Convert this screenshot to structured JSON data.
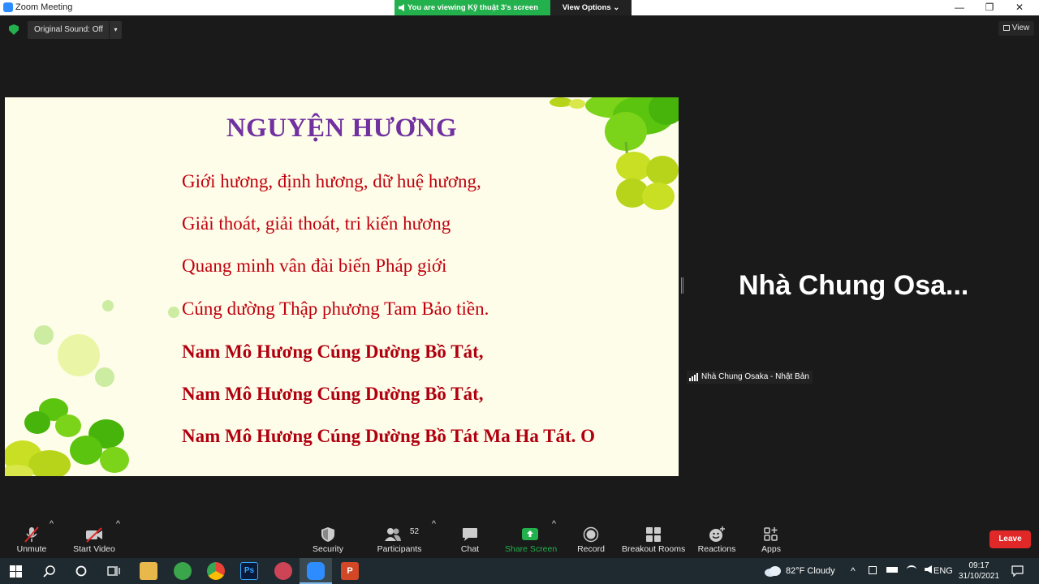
{
  "window": {
    "title": "Zoom Meeting",
    "minimize": "—",
    "restore": "❐",
    "close": "✕"
  },
  "banner": {
    "viewing": "You are viewing Kỹ thuật 3's screen",
    "view_options": "View Options ⌄"
  },
  "topbar": {
    "original_sound": "Original Sound: Off",
    "dropdown_caret": "▾",
    "view_label": "View"
  },
  "slide": {
    "title": "NGUYỆN HƯƠNG",
    "lines": [
      "Giới hương, định hương, dữ huệ hương,",
      "Giải thoát, giải thoát, tri kiến hương",
      "Quang minh vân đài biến Pháp giới",
      "Cúng dường Thập phương Tam Bảo tiền.",
      "Nam Mô Hương Cúng Dường Bồ Tát,",
      "Nam Mô Hương Cúng Dường Bồ Tát,",
      "Nam Mô Hương Cúng Dường Bồ Tát Ma Ha Tát. O"
    ]
  },
  "participant": {
    "big_name": "Nhà Chung Osa...",
    "name_tag": "Nhà Chung Osaka - Nhật Bản"
  },
  "toolbar": {
    "unmute": "Unmute",
    "start_video": "Start Video",
    "security": "Security",
    "participants": "Participants",
    "participants_count": "52",
    "chat": "Chat",
    "share_screen": "Share Screen",
    "record": "Record",
    "breakout_rooms": "Breakout Rooms",
    "reactions": "Reactions",
    "apps": "Apps",
    "leave": "Leave",
    "caret": "^"
  },
  "taskbar": {
    "weather": "82°F  Cloudy",
    "language": "ENG",
    "time": "09:17",
    "date": "31/10/2021",
    "tray_caret": "^"
  },
  "colors": {
    "share_green": "#23b14d",
    "leave_red": "#e02828",
    "slide_title_purple": "#7030a0",
    "slide_text_red": "#c0000e",
    "slide_bg": "#fefde9"
  }
}
